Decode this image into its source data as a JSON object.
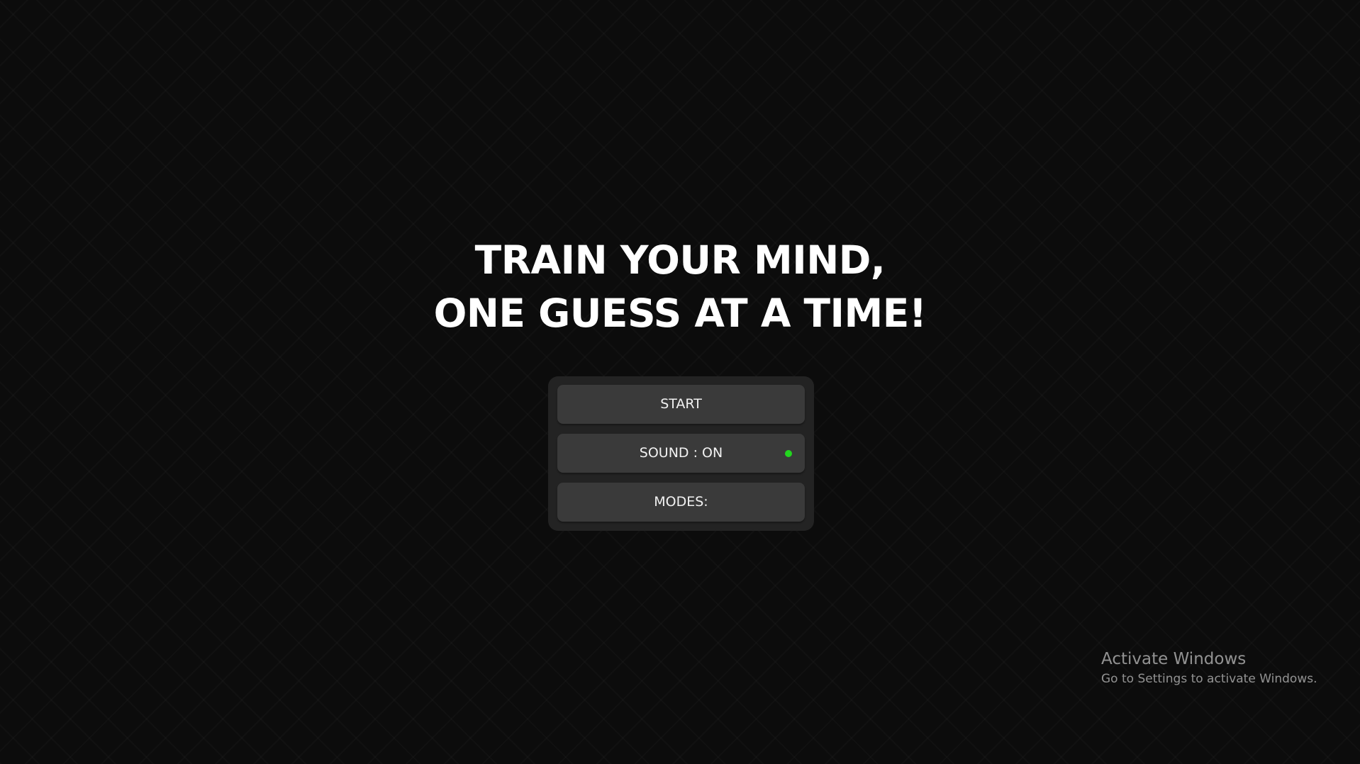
{
  "headline": {
    "line1": "TRAIN YOUR MIND,",
    "line2": "ONE GUESS AT A TIME!"
  },
  "menu": {
    "start_label": "START",
    "sound_label": "SOUND : ON",
    "sound_indicator": {
      "state": "on",
      "color": "#22d61e"
    },
    "modes_label": "MODES:"
  },
  "watermark": {
    "title": "Activate Windows",
    "subtitle": "Go to Settings to activate Windows."
  },
  "colors": {
    "background": "#0c0c0c",
    "menu_panel": "#232323",
    "button": "#3a3a3a",
    "text": "#ffffff"
  }
}
